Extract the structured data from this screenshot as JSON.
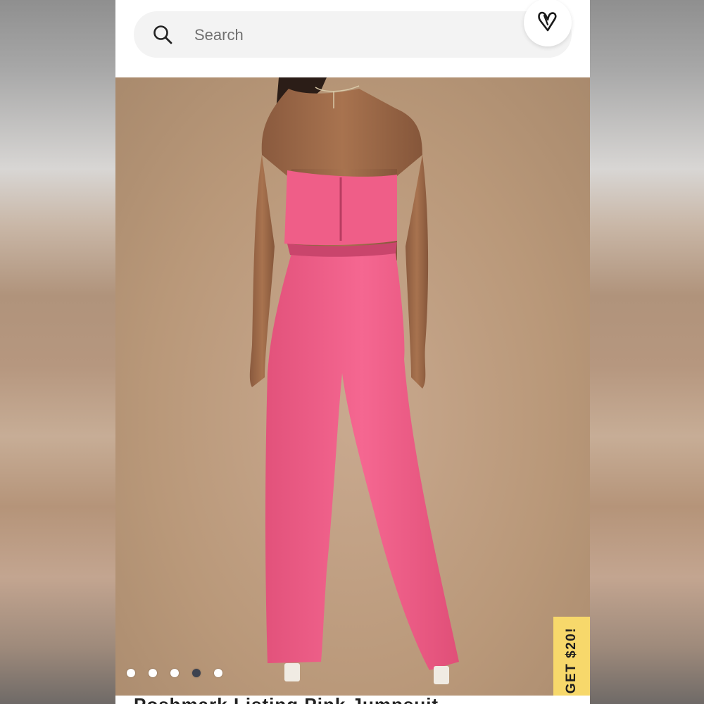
{
  "search": {
    "placeholder": "Search"
  },
  "icons": {
    "search": "search-icon",
    "favorites": "heart-icon"
  },
  "carousel": {
    "total": 5,
    "active_index": 3
  },
  "promo": {
    "label": "GET $20!"
  },
  "product": {
    "title": "Poshmark Listing Pink Jumpsuit"
  },
  "colors": {
    "promo_bg": "#f7d86b",
    "garment": "#f25f8a",
    "backdrop": "#c2a186"
  }
}
